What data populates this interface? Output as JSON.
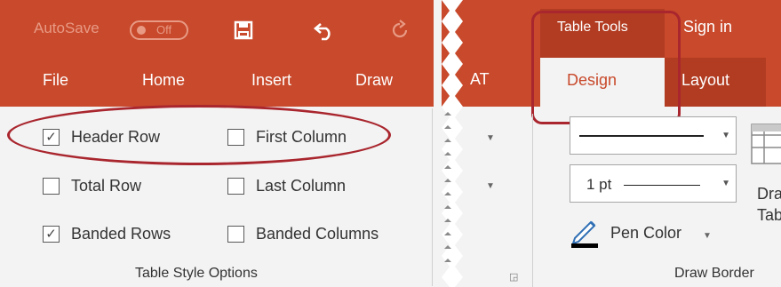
{
  "quick_access": {
    "autosave_label": "AutoSave",
    "autosave_state": "Off",
    "save_icon": "save-icon",
    "undo_icon": "undo-icon",
    "redo_icon": "redo-icon"
  },
  "left_tabs": [
    "File",
    "Home",
    "Insert",
    "Draw"
  ],
  "table_style_options": {
    "group_label": "Table Style Options",
    "options": [
      {
        "label": "Header Row",
        "checked": true
      },
      {
        "label": "First Column",
        "checked": false
      },
      {
        "label": "Total Row",
        "checked": false
      },
      {
        "label": "Last Column",
        "checked": false
      },
      {
        "label": "Banded Rows",
        "checked": true
      },
      {
        "label": "Banded Columns",
        "checked": false
      }
    ]
  },
  "right_ribbon": {
    "table_tools_label": "Table Tools",
    "sign_in": "Sign in",
    "partial_tab": "AT",
    "tabs": [
      "Design",
      "Layout"
    ],
    "active_tab": "Design"
  },
  "draw_borders": {
    "pen_weight": "1 pt",
    "pen_color_label": "Pen Color",
    "group_label": "Draw Border",
    "draw_table_partial_1": "Dra",
    "draw_table_partial_2": "Tab"
  },
  "colors": {
    "ribbon": "#c8492b",
    "highlight_outline": "#a9262e",
    "pane_bg": "#f3f3f3"
  }
}
